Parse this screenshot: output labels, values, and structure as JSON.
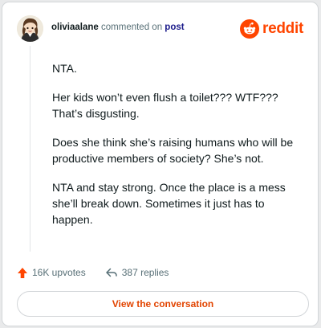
{
  "comment": {
    "username": "oliviaalane",
    "action_text": "commented on",
    "target_link": "post",
    "avatar_icon": "cartoon-avatar-icon",
    "paragraphs": [
      "NTA.",
      "Her kids won’t even flush a toilet??? WTF??? That’s disgusting.",
      "Does she think she’s raising humans who will be productive members of society? She’s not.",
      "NTA and stay strong. Once the place is a mess she’ll break down. Sometimes it just has to happen."
    ]
  },
  "brand": {
    "wordmark": "reddit",
    "icon": "reddit-snoo-icon",
    "color": "#ff4500"
  },
  "stats": {
    "upvotes": "16K upvotes",
    "upvote_icon": "upvote-arrow-icon",
    "replies": "387 replies",
    "reply_icon": "reply-arrow-icon"
  },
  "actions": {
    "view_conversation": "View the conversation"
  }
}
